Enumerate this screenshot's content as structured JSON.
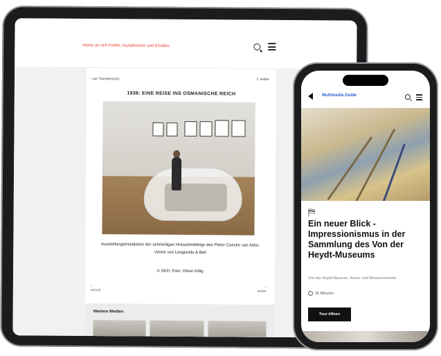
{
  "tablet": {
    "breadcrumb": "Home an rich Fünfte, Kunstkenner und Erleben",
    "back_label": "‹ zur Tourübersicht",
    "further_label": "⇩ weiter",
    "title": "1938: EINE REISE INS OSMANISCHE REICH",
    "caption": "Ausstellungsinstallation der zehnteiligen Holzschnittfolge des Pieter Coecke van Aelst, Vitrine von Longlands & Bell",
    "credit": "© SKD, Foto: Oliver Killig",
    "prev_label": "zurück",
    "next_label": "weiter",
    "more_media_label": "Weitere Medien"
  },
  "phone": {
    "app_title": "Multimedia Guide",
    "headline": "Ein neuer Blick - Impressionismus in der Sammlung des Von der Heydt-Museums",
    "subtitle": "Von der Heydt Museum, Kunst- und Museumsverein",
    "duration": "25 Minuten",
    "open_button": "Tour öffnen",
    "sign_glyph": "⛿"
  },
  "colors": {
    "accent_red": "#e8392d",
    "accent_blue": "#2a5fd0",
    "device_frame": "#1c1c1e"
  }
}
